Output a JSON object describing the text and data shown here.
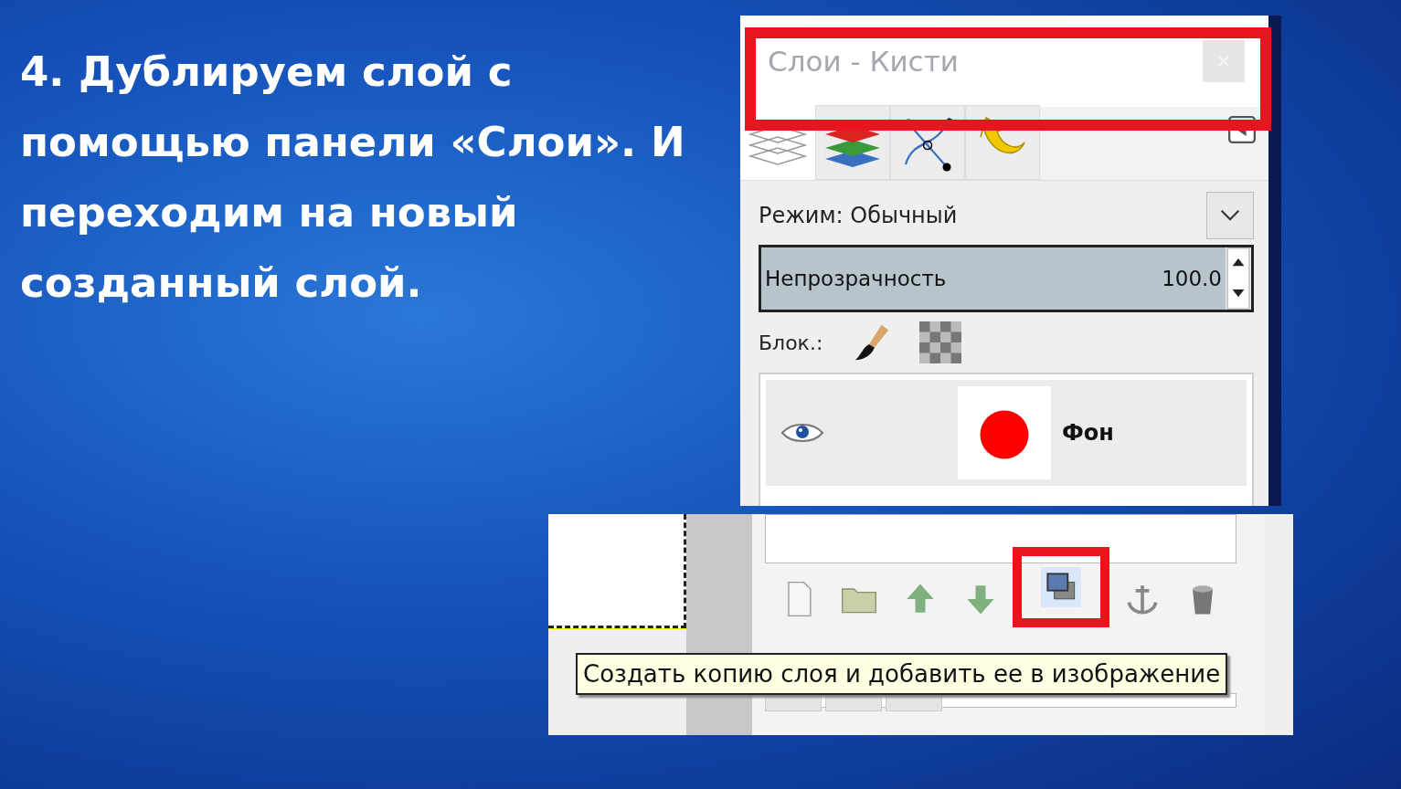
{
  "slide": {
    "text": "4. Дублируем слой с помощью панели «Слои». И переходим на новый созданный слой."
  },
  "layers_panel": {
    "title": "Слои - Кисти",
    "tabs": [
      {
        "kind": "layers",
        "selected": true
      },
      {
        "kind": "channels",
        "selected": false
      },
      {
        "kind": "paths",
        "selected": false
      },
      {
        "kind": "undo",
        "selected": false
      }
    ],
    "mode": {
      "label": "Режим: Обычный"
    },
    "opacity": {
      "label": "Непрозрачность",
      "value": "100.0",
      "level": 1
    },
    "lock": {
      "label": "Блок.:"
    },
    "layers": [
      {
        "name": "Фон",
        "visible": true
      }
    ]
  },
  "layer_buttons": [
    {
      "kind": "new",
      "highlighted": false
    },
    {
      "kind": "folder",
      "highlighted": false
    },
    {
      "kind": "raise",
      "highlighted": false
    },
    {
      "kind": "lower",
      "highlighted": false
    },
    {
      "kind": "duplicate",
      "highlighted": true
    },
    {
      "kind": "anchor",
      "highlighted": false
    },
    {
      "kind": "delete",
      "highlighted": false
    }
  ],
  "tooltip": "Создать копию слоя и добавить ее в изображение"
}
